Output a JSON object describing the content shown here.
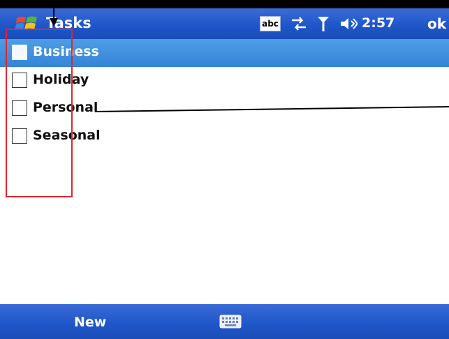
{
  "title_bar": {
    "app_title": "Tasks",
    "input_indicator": "abc",
    "time": "2:57",
    "ok_label": "ok",
    "icons": [
      "windows-start-icon",
      "sync-icon",
      "signal-icon",
      "volume-icon"
    ]
  },
  "task_list": {
    "items": [
      {
        "label": "Business",
        "checked": false,
        "selected": true
      },
      {
        "label": "Holiday",
        "checked": false,
        "selected": false
      },
      {
        "label": "Personal",
        "checked": false,
        "selected": false
      },
      {
        "label": "Seasonal",
        "checked": false,
        "selected": false
      }
    ]
  },
  "menu_bar": {
    "new_label": "New",
    "icon": "keyboard-icon"
  },
  "colors": {
    "bar_blue": "#1f56c9",
    "selection_blue": "#3584d8",
    "annotation_red": "#e0262f"
  }
}
